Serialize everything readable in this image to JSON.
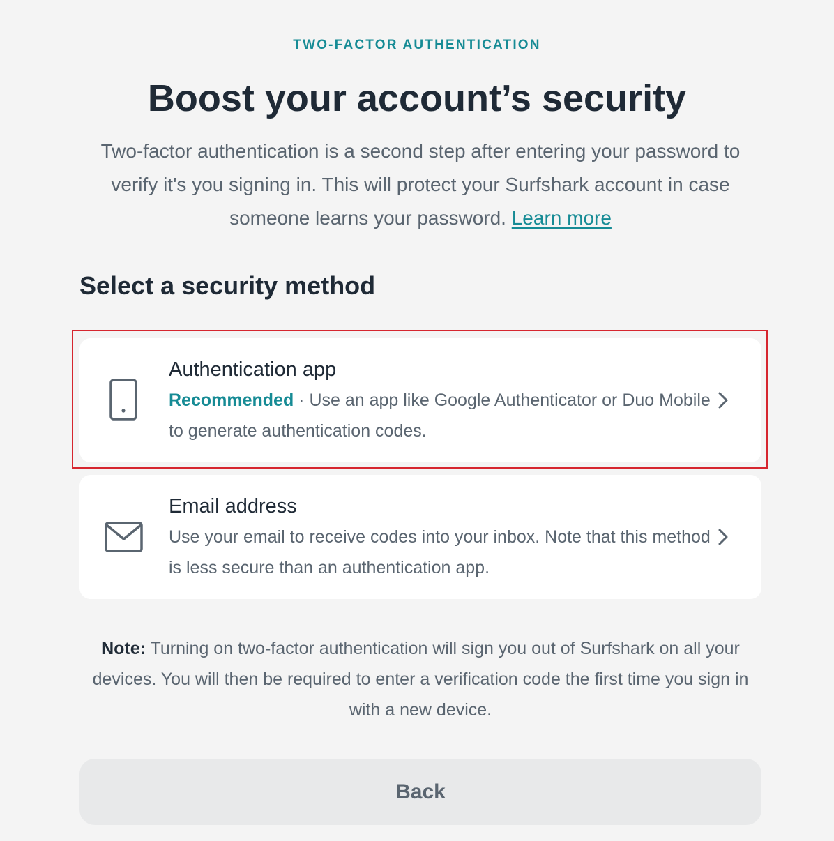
{
  "header": {
    "eyebrow": "TWO-FACTOR AUTHENTICATION",
    "title": "Boost your account’s security",
    "intro_text": "Two-factor authentication is a second step after entering your password to verify it's you signing in. This will protect your Surfshark account in case someone learns your password.",
    "learn_more_label": "Learn more"
  },
  "methods": {
    "section_title": "Select a security method",
    "items": [
      {
        "title": "Authentication app",
        "badge": "Recommended",
        "separator": " · ",
        "description": "Use an app like Google Authenticator or Duo Mobile to generate authentication codes.",
        "icon": "smartphone-icon",
        "highlighted": true
      },
      {
        "title": "Email address",
        "description": "Use your email to receive codes into your inbox. Note that this method is less secure than an authentication app.",
        "icon": "envelope-icon",
        "highlighted": false
      }
    ]
  },
  "note": {
    "label": "Note:",
    "text": " Turning on two-factor authentication will sign you out of Surfshark on all your devices. You will then be required to enter a verification code the first time you sign in with a new device."
  },
  "footer": {
    "back_label": "Back"
  },
  "colors": {
    "accent": "#168b95",
    "heading": "#1f2a36",
    "body_text": "#5a6570",
    "background": "#f4f4f4",
    "card": "#ffffff",
    "highlight_outline": "#d6262f",
    "back_button_bg": "#e8e9ea"
  }
}
